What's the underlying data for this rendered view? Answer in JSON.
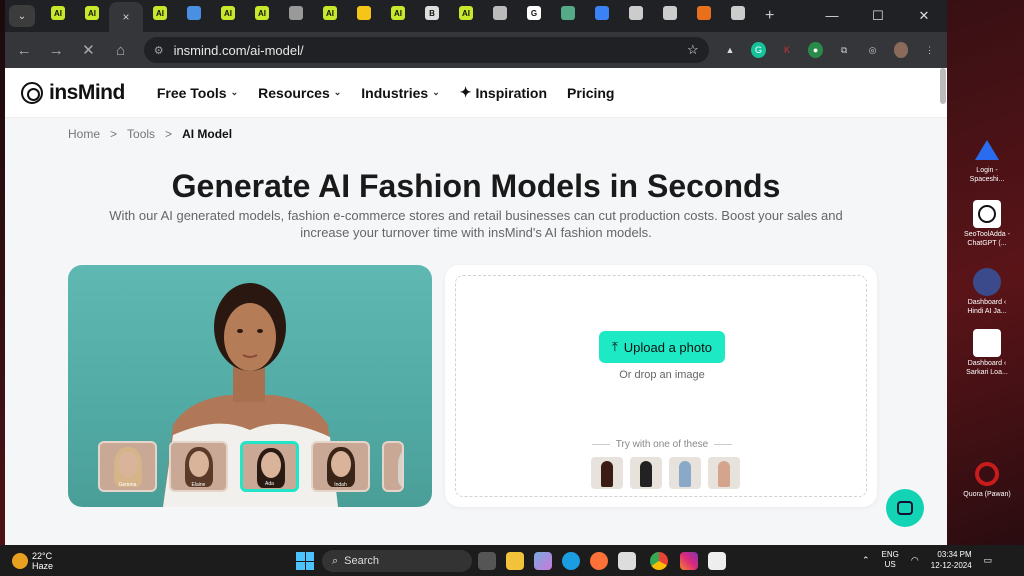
{
  "browser": {
    "tabs": [
      {
        "label": "AI",
        "color": "#c8e82c"
      },
      {
        "label": "AI",
        "color": "#c8e82c"
      },
      {
        "label": "×",
        "color": ""
      },
      {
        "label": "AI",
        "color": "#c8e82c"
      },
      {
        "label": "",
        "color": "#4a90e2"
      },
      {
        "label": "AI",
        "color": "#c8e82c"
      },
      {
        "label": "AI",
        "color": "#c8e82c"
      },
      {
        "label": "",
        "color": "#999"
      },
      {
        "label": "AI",
        "color": "#c8e82c"
      },
      {
        "label": "",
        "color": "#f5c518"
      },
      {
        "label": "AI",
        "color": "#c8e82c"
      },
      {
        "label": "B",
        "color": "#ddd"
      },
      {
        "label": "AI",
        "color": "#c8e82c"
      },
      {
        "label": "",
        "color": "#bbb"
      },
      {
        "label": "G",
        "color": "#fff"
      },
      {
        "label": "",
        "color": "#5a8"
      },
      {
        "label": "",
        "color": "#3b82f6"
      },
      {
        "label": "",
        "color": "#ccc"
      },
      {
        "label": "",
        "color": "#ccc"
      },
      {
        "label": "",
        "color": "#e8701a"
      },
      {
        "label": "",
        "color": "#ccc"
      }
    ],
    "new_tab": "+",
    "url": "insmind.com/ai-model/"
  },
  "site": {
    "logo": "insMind",
    "nav": [
      {
        "label": "Free Tools",
        "chev": "⌄"
      },
      {
        "label": "Resources",
        "chev": "⌄"
      },
      {
        "label": "Industries",
        "chev": "⌄"
      },
      {
        "label": "Inspiration",
        "chev": ""
      },
      {
        "label": "Pricing",
        "chev": ""
      }
    ],
    "breadcrumb": {
      "home": "Home",
      "sep": ">",
      "tools": "Tools",
      "current": "AI Model"
    },
    "title": "Generate AI Fashion Models in Seconds",
    "subtitle": "With our AI generated models, fashion e-commerce stores and retail businesses can cut production costs. Boost your sales and increase your turnover time with insMind's AI fashion models.",
    "models": [
      {
        "name": "Gemma",
        "hair": "#d6b48a"
      },
      {
        "name": "Elaine",
        "hair": "#5a3a28"
      },
      {
        "name": "Ada",
        "hair": "#2a1a12"
      },
      {
        "name": "Indah",
        "hair": "#3a2418"
      },
      {
        "name": "",
        "hair": "#d8d2cc"
      }
    ],
    "upload_button": "Upload a photo",
    "drop_text": "Or drop an image",
    "try_text": "Try with one of these",
    "samples": [
      "#3a1c14",
      "#222",
      "#8aa8c8",
      "#d4a48c"
    ]
  },
  "desktop": {
    "icons": [
      {
        "label": "Login - Spaceshi...",
        "color": "#2a6cf0"
      },
      {
        "label": "SeoToolAdda - ChatGPT (...",
        "color": "#fff"
      },
      {
        "label": "Dashboard ‹ Hindi AI Ja...",
        "color": "#2a6cf0"
      },
      {
        "label": "Dashboard ‹ Sarkari Loa...",
        "color": "#fff"
      },
      {
        "label": "Quora (Pawan)",
        "color": "#c81c1c"
      }
    ]
  },
  "taskbar": {
    "temp": "22°C",
    "weather": "Haze",
    "search": "Search",
    "lang1": "ENG",
    "lang2": "US",
    "time": "03:34 PM",
    "date": "12-12-2024"
  }
}
